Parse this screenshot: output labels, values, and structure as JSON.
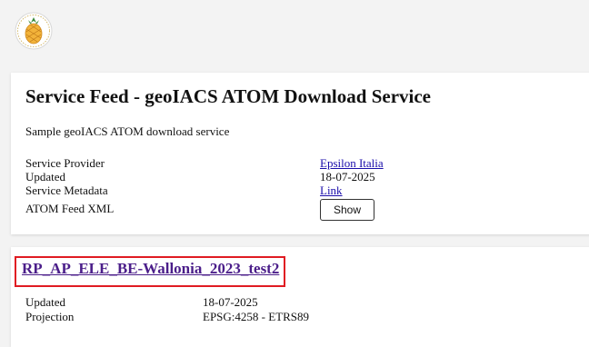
{
  "header": {
    "logo_icon": "pineapple-logo-icon"
  },
  "service": {
    "title": "Service Feed - geoIACS ATOM Download Service",
    "description": "Sample geoIACS ATOM download service",
    "fields": {
      "provider_label": "Service Provider",
      "provider_value": "Epsilon Italia",
      "updated_label": "Updated",
      "updated_value": "18-07-2025",
      "metadata_label": "Service Metadata",
      "metadata_value": "Link",
      "xml_label": "ATOM Feed XML",
      "xml_button": "Show"
    }
  },
  "feed": {
    "title": "RP_AP_ELE_BE-Wallonia_2023_test2",
    "highlight_color": "#e01b22",
    "updated_label": "Updated",
    "updated_value": "18-07-2025",
    "projection_label": "Projection",
    "projection_value": "EPSG:4258 - ETRS89"
  }
}
